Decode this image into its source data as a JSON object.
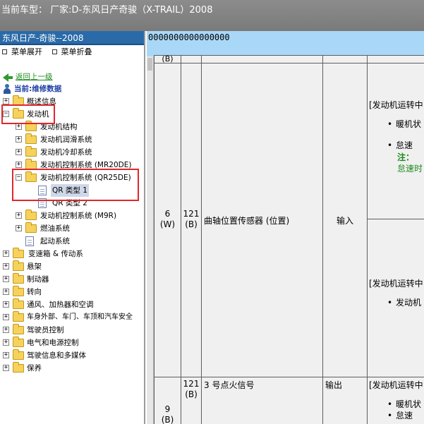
{
  "title_bar": {
    "text": "当前车型：  厂家:D-东风日产奇骏（X-TRAIL）2008"
  },
  "left_panel": {
    "header": "东风日产-奇骏--2008",
    "expand_menu": "菜单展开",
    "collapse_menu": "菜单折叠",
    "back_link": "返回上一级",
    "current_label": "当前:维修数据",
    "tree": [
      {
        "label": "概述信息",
        "type": "folder",
        "toggle": "+"
      },
      {
        "label": "发动机",
        "type": "folder",
        "toggle": "−"
      },
      {
        "label": "发动机结构",
        "type": "folder",
        "toggle": "+"
      },
      {
        "label": "发动机润滑系统",
        "type": "folder",
        "toggle": "+"
      },
      {
        "label": "发动机冷却系统",
        "type": "folder",
        "toggle": "+"
      },
      {
        "label": "发动机控制系统 (MR20DE)",
        "type": "folder",
        "toggle": "+"
      },
      {
        "label": "发动机控制系统 (QR25DE)",
        "type": "folder",
        "toggle": "−"
      },
      {
        "label": "QR 类型 1",
        "type": "page",
        "toggle": ""
      },
      {
        "label": "QR 类型 2",
        "type": "page",
        "toggle": ""
      },
      {
        "label": "发动机控制系统 (M9R)",
        "type": "folder",
        "toggle": "+"
      },
      {
        "label": "燃油系统",
        "type": "folder",
        "toggle": "+"
      },
      {
        "label": "起动系统",
        "type": "page",
        "toggle": ""
      },
      {
        "label": "变速箱 & 传动系",
        "type": "folder",
        "toggle": "+"
      },
      {
        "label": "悬架",
        "type": "folder",
        "toggle": "+"
      },
      {
        "label": "制动器",
        "type": "folder",
        "toggle": "+"
      },
      {
        "label": "转向",
        "type": "folder",
        "toggle": "+"
      },
      {
        "label": "通风、加热器和空调",
        "type": "folder",
        "toggle": "+"
      },
      {
        "label": "车身外部、车门、车顶和汽车安全",
        "type": "folder",
        "toggle": "+"
      },
      {
        "label": "驾驶员控制",
        "type": "folder",
        "toggle": "+"
      },
      {
        "label": "电气和电源控制",
        "type": "folder",
        "toggle": "+"
      },
      {
        "label": "驾驶信息和多媒体",
        "type": "folder",
        "toggle": "+"
      },
      {
        "label": "保养",
        "type": "folder",
        "toggle": "+"
      }
    ]
  },
  "right_panel": {
    "header_text": "0000000000000000",
    "top_partial": "(B)",
    "row1": {
      "terminal_no": "6",
      "terminal_color": "(W)",
      "ground_no": "121",
      "ground_color": "(B)",
      "description": "曲轴位置传感器 (位置)",
      "io": "输入",
      "cond1_header": "[发动机运转中",
      "cond1_item1": "暖机状",
      "cond1_item2": "怠速",
      "note_label": "注：",
      "note_text": "怠速时",
      "cond2_header": "[发动机运转中",
      "cond2_item1": "发动机"
    },
    "row2": {
      "terminal_no": "9",
      "terminal_color": "(B)",
      "ground_no": "121",
      "ground_color": "(B)",
      "description": "3 号点火信号",
      "io": "输出",
      "cond_header": "[发动机运转中",
      "cond_item1": "暖机状",
      "cond_item2": "怠速"
    }
  }
}
